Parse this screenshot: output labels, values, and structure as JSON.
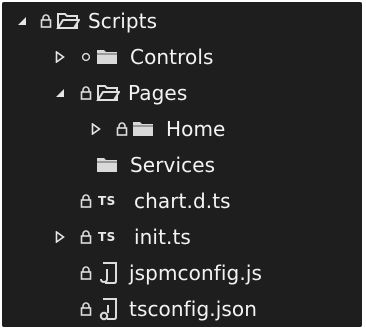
{
  "tree": {
    "items": [
      {
        "label": "Scripts",
        "state": "expanded",
        "marker": "lock",
        "icon": "folder-open"
      },
      {
        "label": "Controls",
        "state": "collapsed",
        "marker": "circle",
        "icon": "folder"
      },
      {
        "label": "Pages",
        "state": "expanded",
        "marker": "lock",
        "icon": "folder-open"
      },
      {
        "label": "Home",
        "state": "collapsed",
        "marker": "lock",
        "icon": "folder"
      },
      {
        "label": "Services",
        "state": "none",
        "marker": "none",
        "icon": "folder"
      },
      {
        "label": "chart.d.ts",
        "state": "none",
        "marker": "lock",
        "icon": "ts-file",
        "badge": "TS"
      },
      {
        "label": "init.ts",
        "state": "collapsed",
        "marker": "lock",
        "icon": "ts-file",
        "badge": "TS"
      },
      {
        "label": "jspmconfig.js",
        "state": "none",
        "marker": "lock",
        "icon": "js-file"
      },
      {
        "label": "tsconfig.json",
        "state": "none",
        "marker": "lock",
        "icon": "json-file"
      }
    ]
  },
  "colors": {
    "background": "#1e1e1e",
    "text": "#f3f3f3",
    "icon": "#d8d8d8"
  }
}
